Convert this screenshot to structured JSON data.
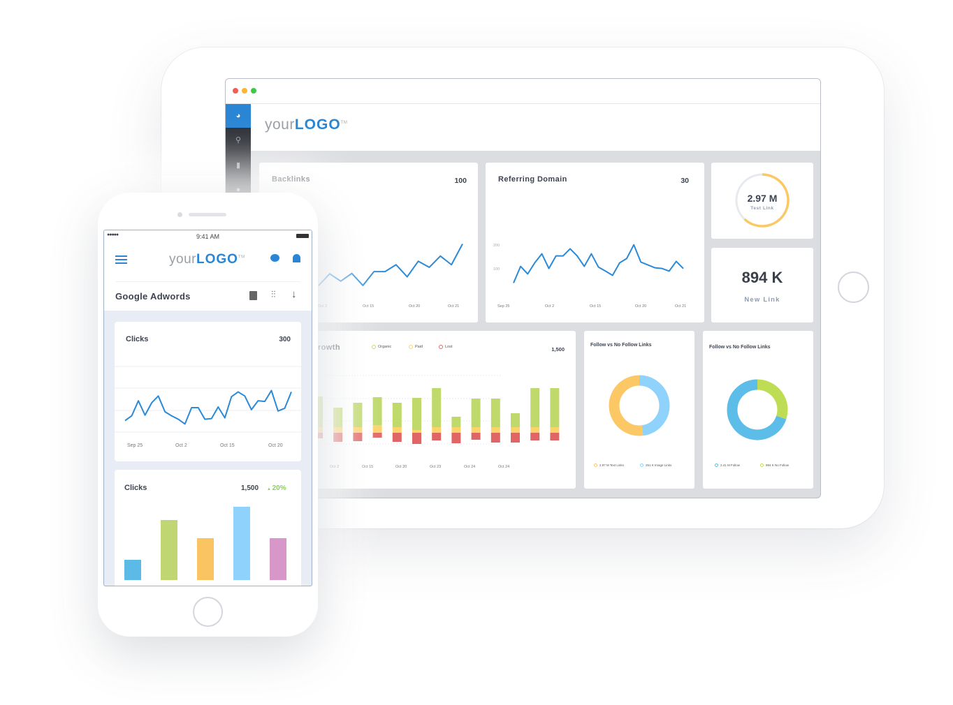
{
  "tablet": {
    "window_dots": [
      "#f25c54",
      "#f7b731",
      "#3ec94a"
    ],
    "sidebar_icons": [
      "dashboard-icon",
      "search-icon",
      "bar-chart-icon",
      "chat-icon"
    ],
    "logo": {
      "light": "your",
      "bold": "LOGO",
      "tm": "TM"
    },
    "backlinks": {
      "title": "Backlinks",
      "value": "100",
      "x_ticks": [
        "Oct 2",
        "Oct 15",
        "Oct 20",
        "Oct 21"
      ],
      "values": [
        50,
        77,
        60,
        78,
        50,
        82,
        82,
        98,
        70,
        106,
        92,
        118,
        98,
        146
      ]
    },
    "referring_domain": {
      "title": "Referring Domain",
      "value": "30",
      "y_ticks": [
        "200",
        "100"
      ],
      "x_ticks": [
        "Sep 25",
        "Oct 2",
        "Oct 15",
        "Oct 20",
        "Oct 21"
      ],
      "values": [
        65,
        135,
        103,
        150,
        188,
        126,
        179,
        179,
        209,
        179,
        135,
        188,
        132,
        115,
        97,
        150,
        168,
        226,
        153,
        141,
        129,
        126,
        115,
        156,
        126
      ]
    },
    "kpi_test_link": {
      "value": "2.97 M",
      "label": "Test Link",
      "progress": 0.62
    },
    "kpi_new_link": {
      "value": "894 K",
      "label": "New Link"
    },
    "growth": {
      "title": "rowth",
      "value": "1,500",
      "legend": [
        {
          "label": "Organic",
          "color": "#bfd96a"
        },
        {
          "label": "Paid",
          "color": "#fbd36b"
        },
        {
          "label": "Lost",
          "color": "#e06666"
        }
      ],
      "x_ticks": [
        "Oct 2",
        "Oct 15",
        "Oct 20",
        "Oct 23",
        "Oct 24",
        "Oct 24"
      ],
      "organic": [
        44,
        28,
        35,
        40,
        35,
        46,
        56,
        15,
        41,
        41,
        20,
        56,
        56
      ],
      "paid": [
        8,
        8,
        8,
        11,
        8,
        4,
        8,
        8,
        8,
        8,
        8,
        8,
        8
      ],
      "lost": [
        8,
        13,
        12,
        7,
        13,
        16,
        11,
        15,
        10,
        14,
        14,
        11,
        11
      ]
    },
    "follow_1": {
      "title": "Follow vs  No Follow Links",
      "slices": [
        {
          "label": "2.97 M Text Links",
          "share": 0.52,
          "color": "#fcc865"
        },
        {
          "label": "251 K Image Links",
          "share": 0.48,
          "color": "#8fd3fc"
        }
      ]
    },
    "follow_2": {
      "title": "Follow vs  No Follow Links",
      "slices": [
        {
          "label": "2.41 M Follow",
          "share": 0.7,
          "color": "#5bbde8"
        },
        {
          "label": "994 K No Follow",
          "share": 0.3,
          "color": "#bfdc55"
        }
      ]
    }
  },
  "phone": {
    "status": {
      "time": "9:41 AM"
    },
    "logo": {
      "light": "your",
      "bold": "LOGO",
      "tm": "TM"
    },
    "section_title": "Google Adwords",
    "clicks_line": {
      "title": "Clicks",
      "value": "300",
      "x_ticks": [
        "Sep 25",
        "Oct 2",
        "Oct 15",
        "Oct 20"
      ],
      "values": [
        29,
        36,
        58,
        37,
        55,
        65,
        42,
        36,
        31,
        24,
        48,
        48,
        31,
        32,
        49,
        33,
        64,
        71,
        65,
        45,
        58,
        57,
        73,
        43,
        47,
        71
      ]
    },
    "clicks_bar": {
      "title": "Clicks",
      "value": "1,500",
      "change": "20%",
      "values": [
        29,
        86,
        60,
        105,
        60
      ],
      "colors": [
        "#5bbbe6",
        "#c0d672",
        "#fbc463",
        "#8fd3fc",
        "#d897c9"
      ]
    }
  }
}
